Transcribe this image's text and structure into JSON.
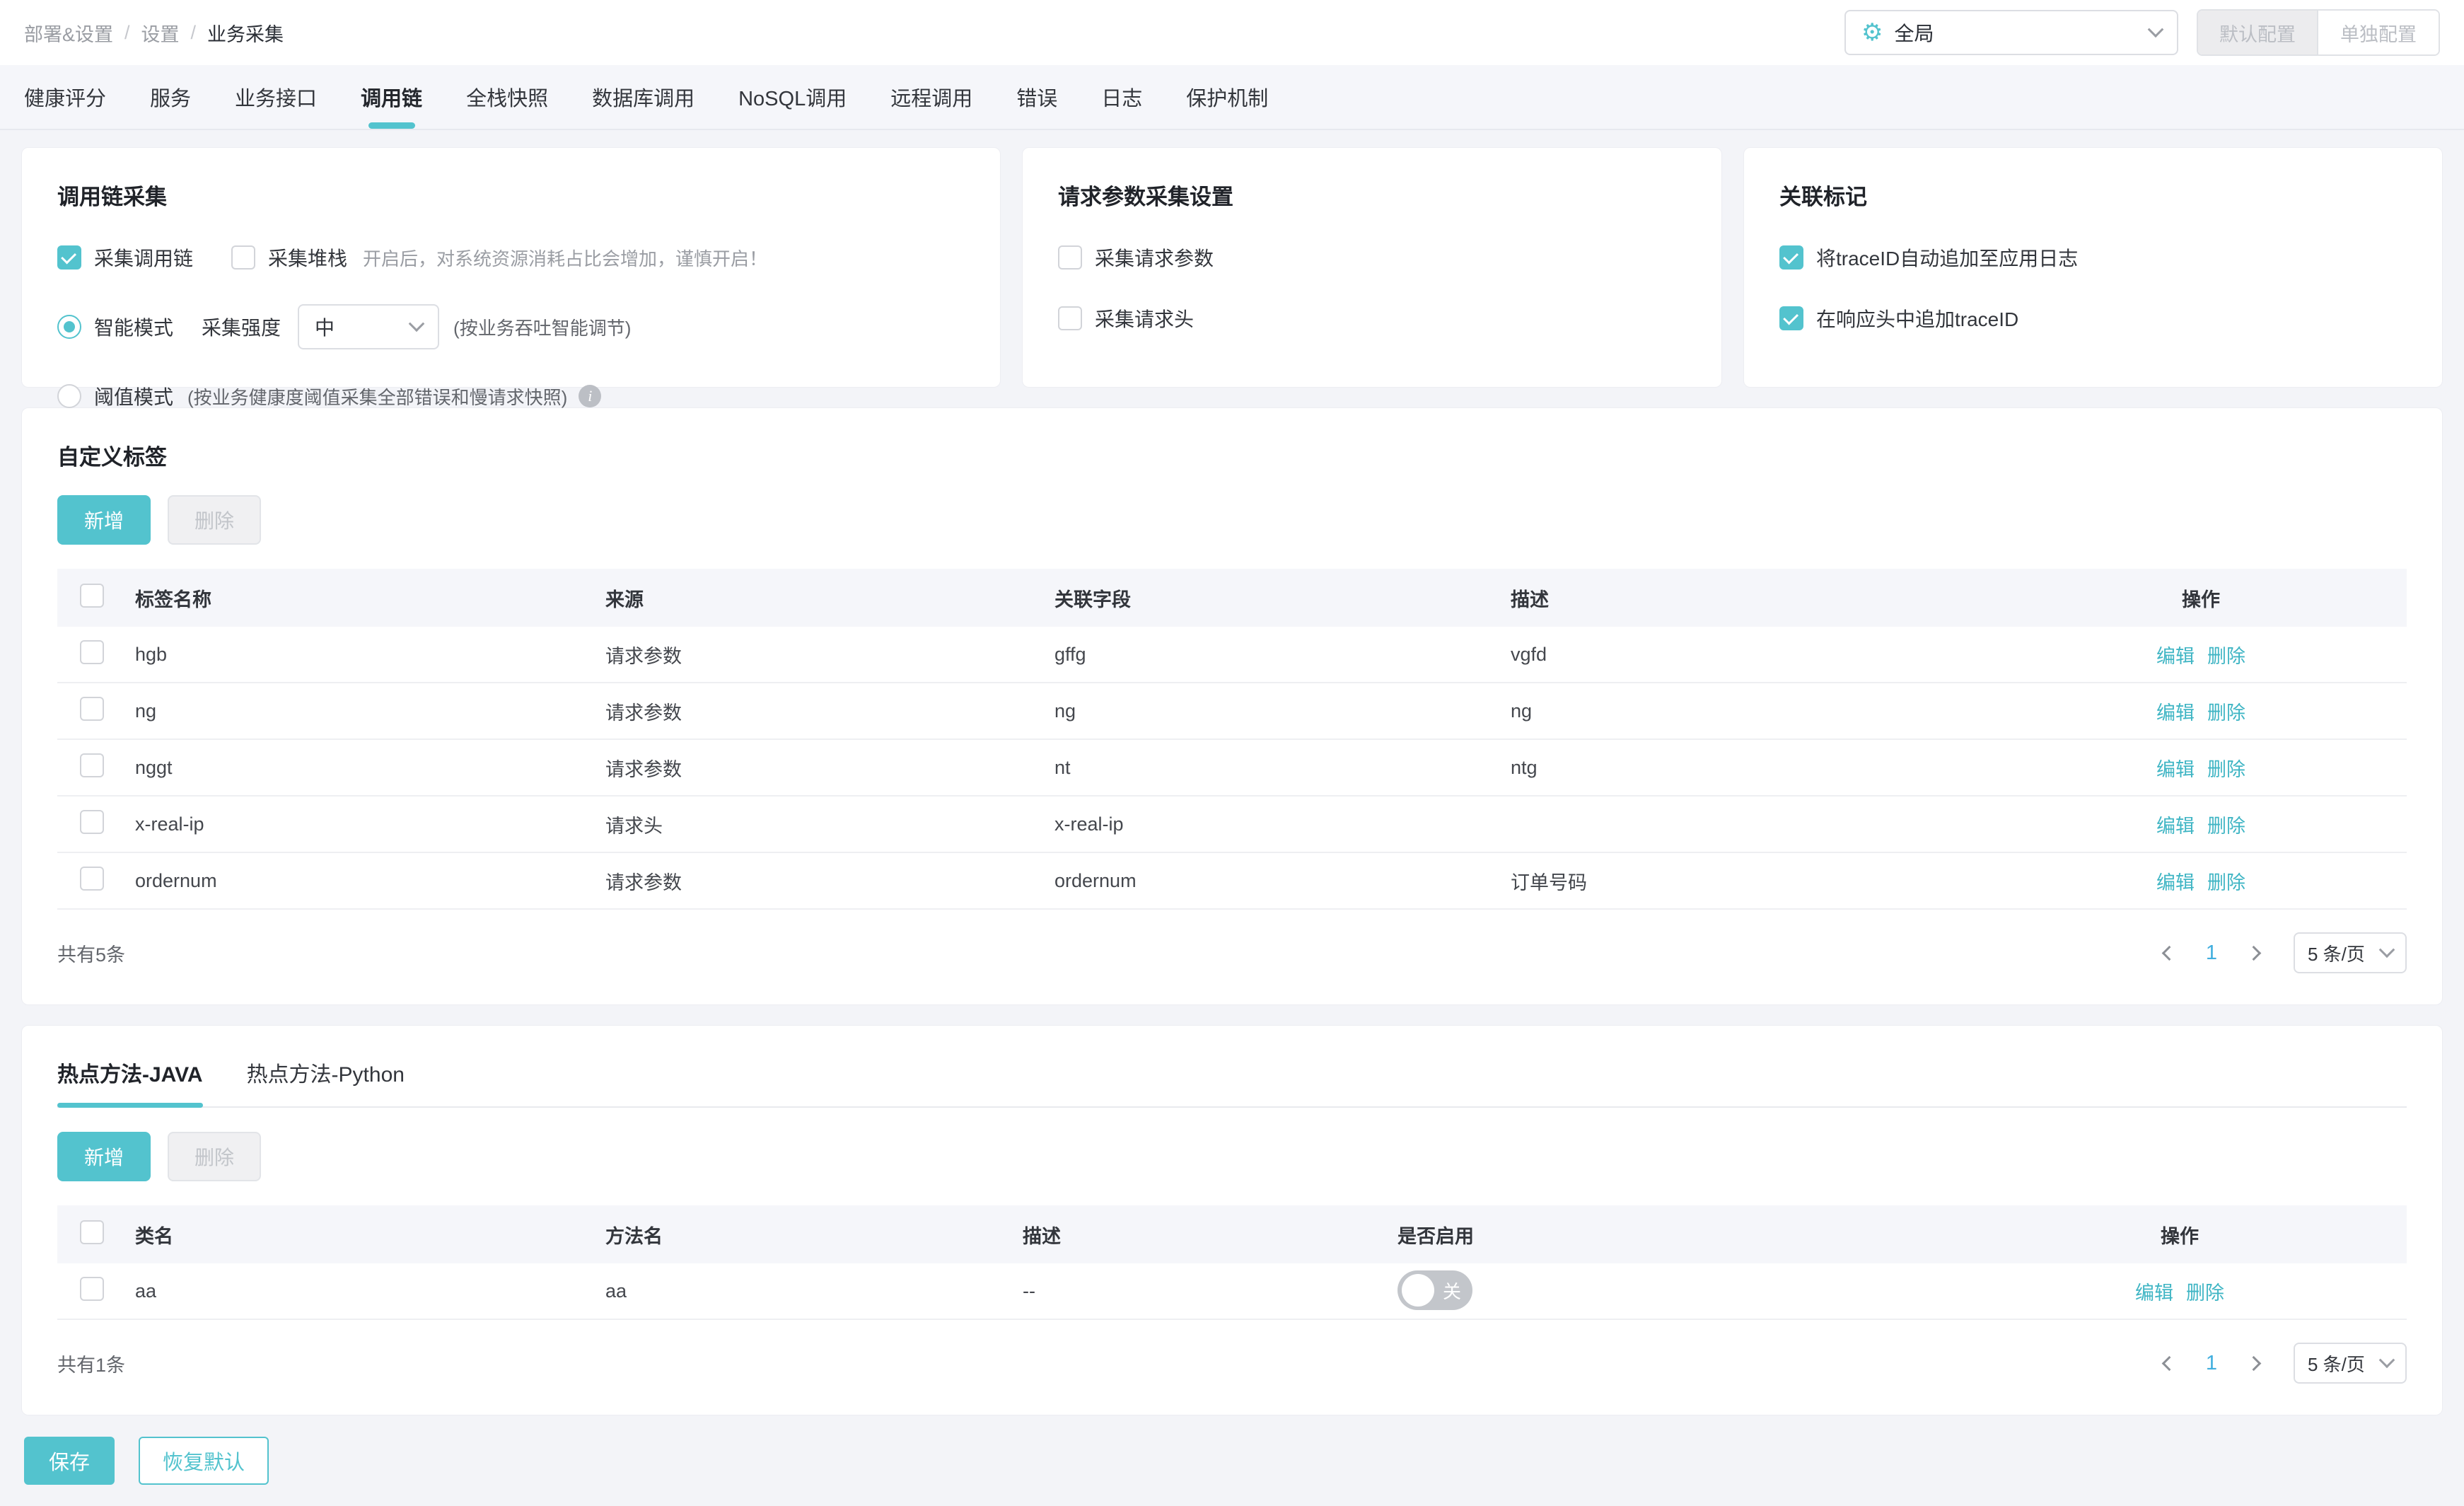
{
  "colors": {
    "accent": "#53C3CE",
    "link": "#3FB5C4",
    "page_number": "#40AEDE",
    "toggle_off": "#C3C6CB"
  },
  "icons": {
    "gear": "⚙",
    "info": "i"
  },
  "breadcrumb": {
    "items": [
      "部署&设置",
      "设置",
      "业务采集"
    ],
    "separator": "/"
  },
  "header": {
    "scope_select": {
      "value": "全局"
    },
    "default_config_button": "默认配置",
    "separate_config_button": "单独配置"
  },
  "tabs": {
    "items": [
      "健康评分",
      "服务",
      "业务接口",
      "调用链",
      "全栈快照",
      "数据库调用",
      "NoSQL调用",
      "远程调用",
      "错误",
      "日志",
      "保护机制"
    ],
    "active": "调用链"
  },
  "panels": {
    "trace_collection": {
      "title": "调用链采集",
      "collect_trace": {
        "label": "采集调用链",
        "checked": true
      },
      "collect_stack": {
        "label": "采集堆栈",
        "checked": false,
        "hint": "开启后，对系统资源消耗占比会增加，谨慎开启！"
      },
      "smart_mode": {
        "label": "智能模式",
        "selected": true,
        "strength_label": "采集强度",
        "strength_value": "中",
        "hint": "(按业务吞吐智能调节)"
      },
      "threshold_mode": {
        "label": "阈值模式",
        "selected": false,
        "hint": "(按业务健康度阈值采集全部错误和慢请求快照)"
      }
    },
    "request_params": {
      "title": "请求参数采集设置",
      "collect_params": {
        "label": "采集请求参数",
        "checked": false
      },
      "collect_headers": {
        "label": "采集请求头",
        "checked": false
      }
    },
    "trace_marking": {
      "title": "关联标记",
      "append_to_log": {
        "label": "将traceID自动追加至应用日志",
        "checked": true
      },
      "append_to_header": {
        "label": "在响应头中追加traceID",
        "checked": true
      }
    }
  },
  "custom_tags": {
    "title": "自定义标签",
    "add_button": "新增",
    "delete_button": "删除",
    "table": {
      "columns": [
        "标签名称",
        "来源",
        "关联字段",
        "描述",
        "操作"
      ],
      "edit_label": "编辑",
      "delete_label": "删除",
      "rows": [
        {
          "name": "hgb",
          "source": "请求参数",
          "field": "gffg",
          "desc": "vgfd"
        },
        {
          "name": "ng",
          "source": "请求参数",
          "field": "ng",
          "desc": "ng"
        },
        {
          "name": "nggt",
          "source": "请求参数",
          "field": "nt",
          "desc": "ntg"
        },
        {
          "name": "x-real-ip",
          "source": "请求头",
          "field": "x-real-ip",
          "desc": ""
        },
        {
          "name": "ordernum",
          "source": "请求参数",
          "field": "ordernum",
          "desc": "订单号码"
        }
      ]
    },
    "pagination": {
      "total": "共有5条",
      "page": "1",
      "page_size": "5 条/页"
    }
  },
  "hot_methods": {
    "tabs": [
      {
        "label": "热点方法-JAVA",
        "active": true
      },
      {
        "label": "热点方法-Python",
        "active": false
      }
    ],
    "add_button": "新增",
    "delete_button": "删除",
    "table": {
      "columns": [
        "类名",
        "方法名",
        "描述",
        "是否启用",
        "操作"
      ],
      "edit_label": "编辑",
      "delete_label": "删除",
      "rows": [
        {
          "class_name": "aa",
          "method_name": "aa",
          "desc": "--",
          "enabled": false,
          "toggle_label": "关"
        }
      ]
    },
    "pagination": {
      "total": "共有1条",
      "page": "1",
      "page_size": "5 条/页"
    }
  },
  "footer": {
    "save_button": "保存",
    "reset_button": "恢复默认"
  }
}
